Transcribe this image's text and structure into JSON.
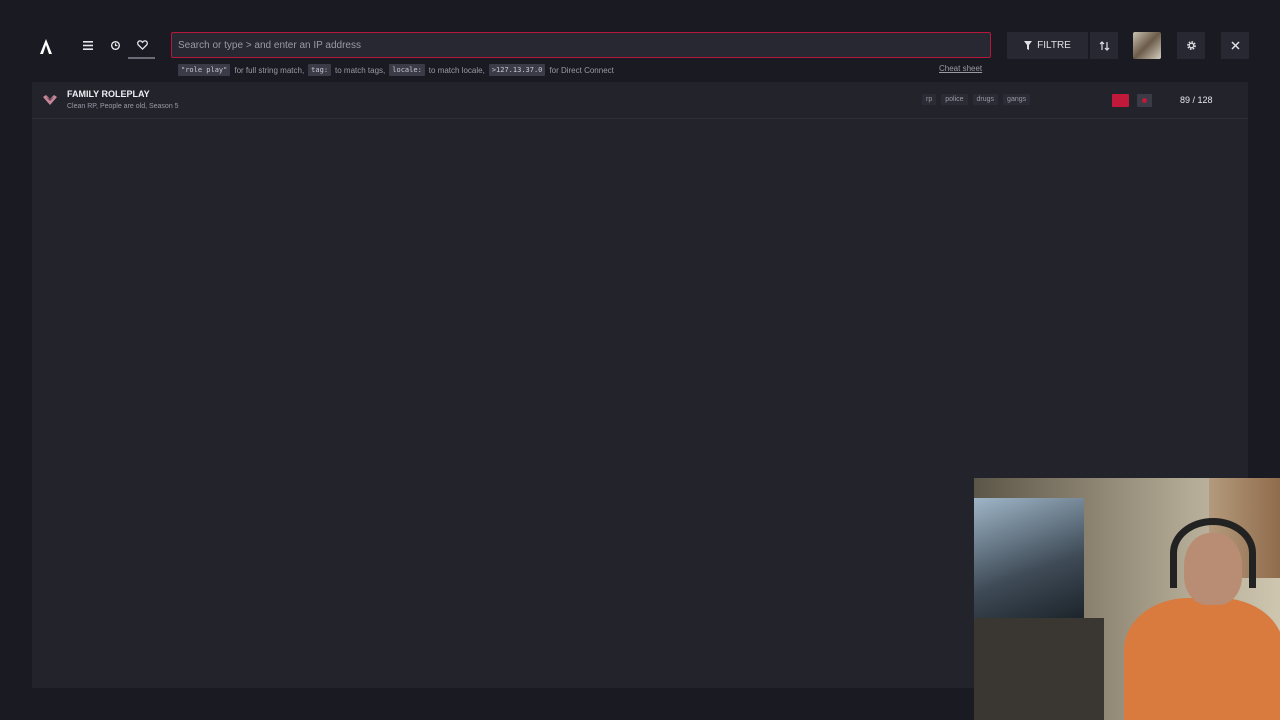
{
  "search": {
    "placeholder": "Search or type > and enter an IP address",
    "hints": [
      {
        "code": "\"role play\"",
        "text": "for full string match,"
      },
      {
        "code": "tag:",
        "text": "to match tags,"
      },
      {
        "code": "locale:",
        "text": "to match locale,"
      },
      {
        "code": ">127.13.37.0",
        "text": "for Direct Connect"
      }
    ],
    "cheat_sheet": "Cheat sheet"
  },
  "toolbar": {
    "filter_label": "FILTRE"
  },
  "servers": [
    {
      "name": "FAMILY ROLEPLAY",
      "description": "Clean RP, People are old, Season 5",
      "tags": [
        "rp",
        "police",
        "drugs",
        "gangs"
      ],
      "players": "89 / 128"
    }
  ],
  "colors": {
    "accent": "#c0193a",
    "background": "#1a1b22",
    "panel": "#22232b"
  },
  "icons": [
    "logo-icon",
    "menu-icon",
    "history-icon",
    "favorites-icon",
    "filter-icon",
    "sort-icon",
    "settings-icon",
    "close-icon"
  ]
}
